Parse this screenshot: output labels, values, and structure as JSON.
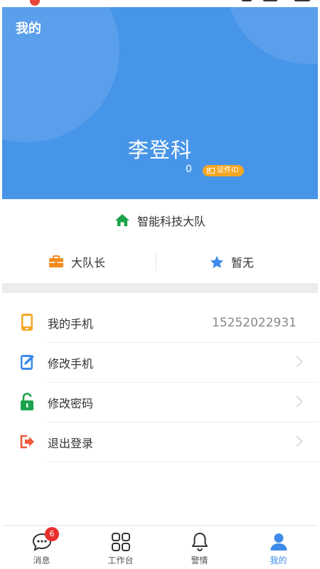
{
  "header": {
    "title": "我的",
    "user_name": "李登科",
    "count": "0",
    "badge_label": "证件ID",
    "colors": {
      "background": "#4795e9",
      "badge": "#f5a623"
    }
  },
  "team": {
    "icon": "home-icon",
    "name": "智能科技大队",
    "icon_color": "#1aa34a"
  },
  "roles": {
    "position": {
      "icon": "briefcase-icon",
      "label": "大队长",
      "icon_color": "#f08a1d"
    },
    "rank": {
      "icon": "star-icon",
      "label": "暂无",
      "icon_color": "#3d8ae8"
    }
  },
  "menu": [
    {
      "icon": "phone-icon",
      "label": "我的手机",
      "value": "15252022931",
      "icon_color": "#f5a623"
    },
    {
      "icon": "edit-icon",
      "label": "修改手机",
      "icon_color": "#3d8ae8"
    },
    {
      "icon": "unlock-icon",
      "label": "修改密码",
      "icon_color": "#1aa34a"
    },
    {
      "icon": "logout-icon",
      "label": "退出登录",
      "icon_color": "#ee5a3c"
    }
  ],
  "tabbar": {
    "items": [
      {
        "icon": "chat-icon",
        "label": "消息",
        "badge": "6"
      },
      {
        "icon": "grid-icon",
        "label": "工作台"
      },
      {
        "icon": "bell-icon",
        "label": "警情"
      },
      {
        "icon": "user-icon",
        "label": "我的",
        "active": true
      }
    ],
    "active_color": "#3d8ae8"
  }
}
